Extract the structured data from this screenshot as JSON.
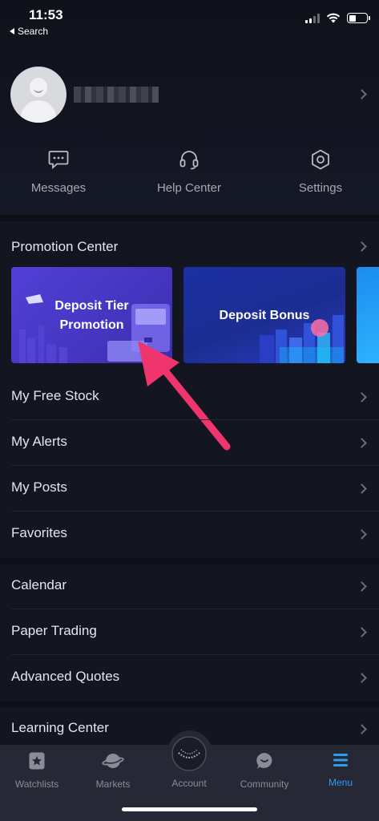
{
  "status_bar": {
    "time": "11:53",
    "back_label": "Search"
  },
  "profile": {
    "username_hidden": true
  },
  "quick_actions": [
    {
      "label": "Messages",
      "icon": "message-icon"
    },
    {
      "label": "Help Center",
      "icon": "headset-icon"
    },
    {
      "label": "Settings",
      "icon": "gear-icon"
    }
  ],
  "promotion": {
    "title": "Promotion Center",
    "cards": [
      {
        "title_line1": "Deposit Tier",
        "title_line2": "Promotion"
      },
      {
        "title": "Deposit Bonus"
      }
    ]
  },
  "menu_group1": [
    "My Free Stock",
    "My Alerts",
    "My Posts",
    "Favorites"
  ],
  "menu_group2": [
    "Calendar",
    "Paper Trading",
    "Advanced Quotes"
  ],
  "menu_group3": [
    "Learning Center"
  ],
  "tabbar": {
    "tabs": [
      {
        "label": "Watchlists",
        "icon": "star-icon"
      },
      {
        "label": "Markets",
        "icon": "planet-icon"
      },
      {
        "label": "Account",
        "icon": "account-icon"
      },
      {
        "label": "Community",
        "icon": "chat-icon"
      },
      {
        "label": "Menu",
        "icon": "menu-icon"
      }
    ],
    "active": "Menu"
  },
  "colors": {
    "accent": "#2d9cf0",
    "arrow": "#f0356e",
    "background": "#131521"
  }
}
